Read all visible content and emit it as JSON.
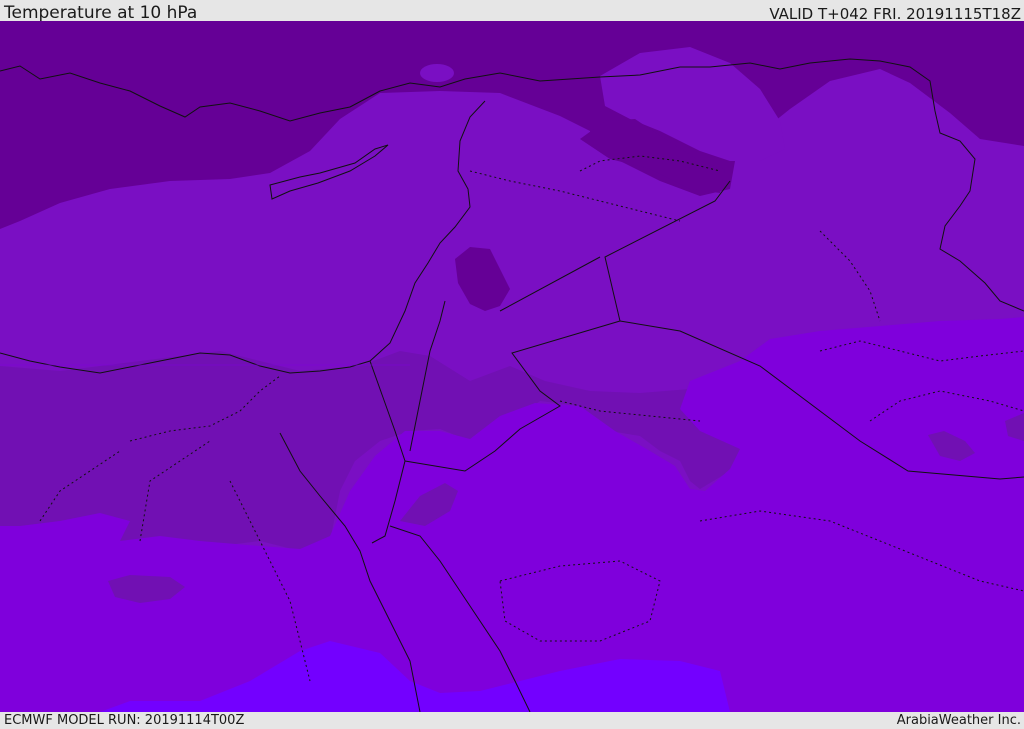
{
  "header": {
    "title": "Temperature at 10 hPa",
    "valid_time": "VALID T+042 FRI. 20191115T18Z"
  },
  "footer": {
    "model_run": "ECMWF MODEL RUN: 20191114T00Z",
    "credit": "ArabiaWeather Inc."
  },
  "colors": {
    "band_darkest": "#650096",
    "band_dark": "#7110b3",
    "band_mid": "#7a0fc3",
    "band_bright": "#7f00dc",
    "band_brightest": "#7300ff",
    "border_line": "#111111",
    "background": "#e6e6e6"
  }
}
